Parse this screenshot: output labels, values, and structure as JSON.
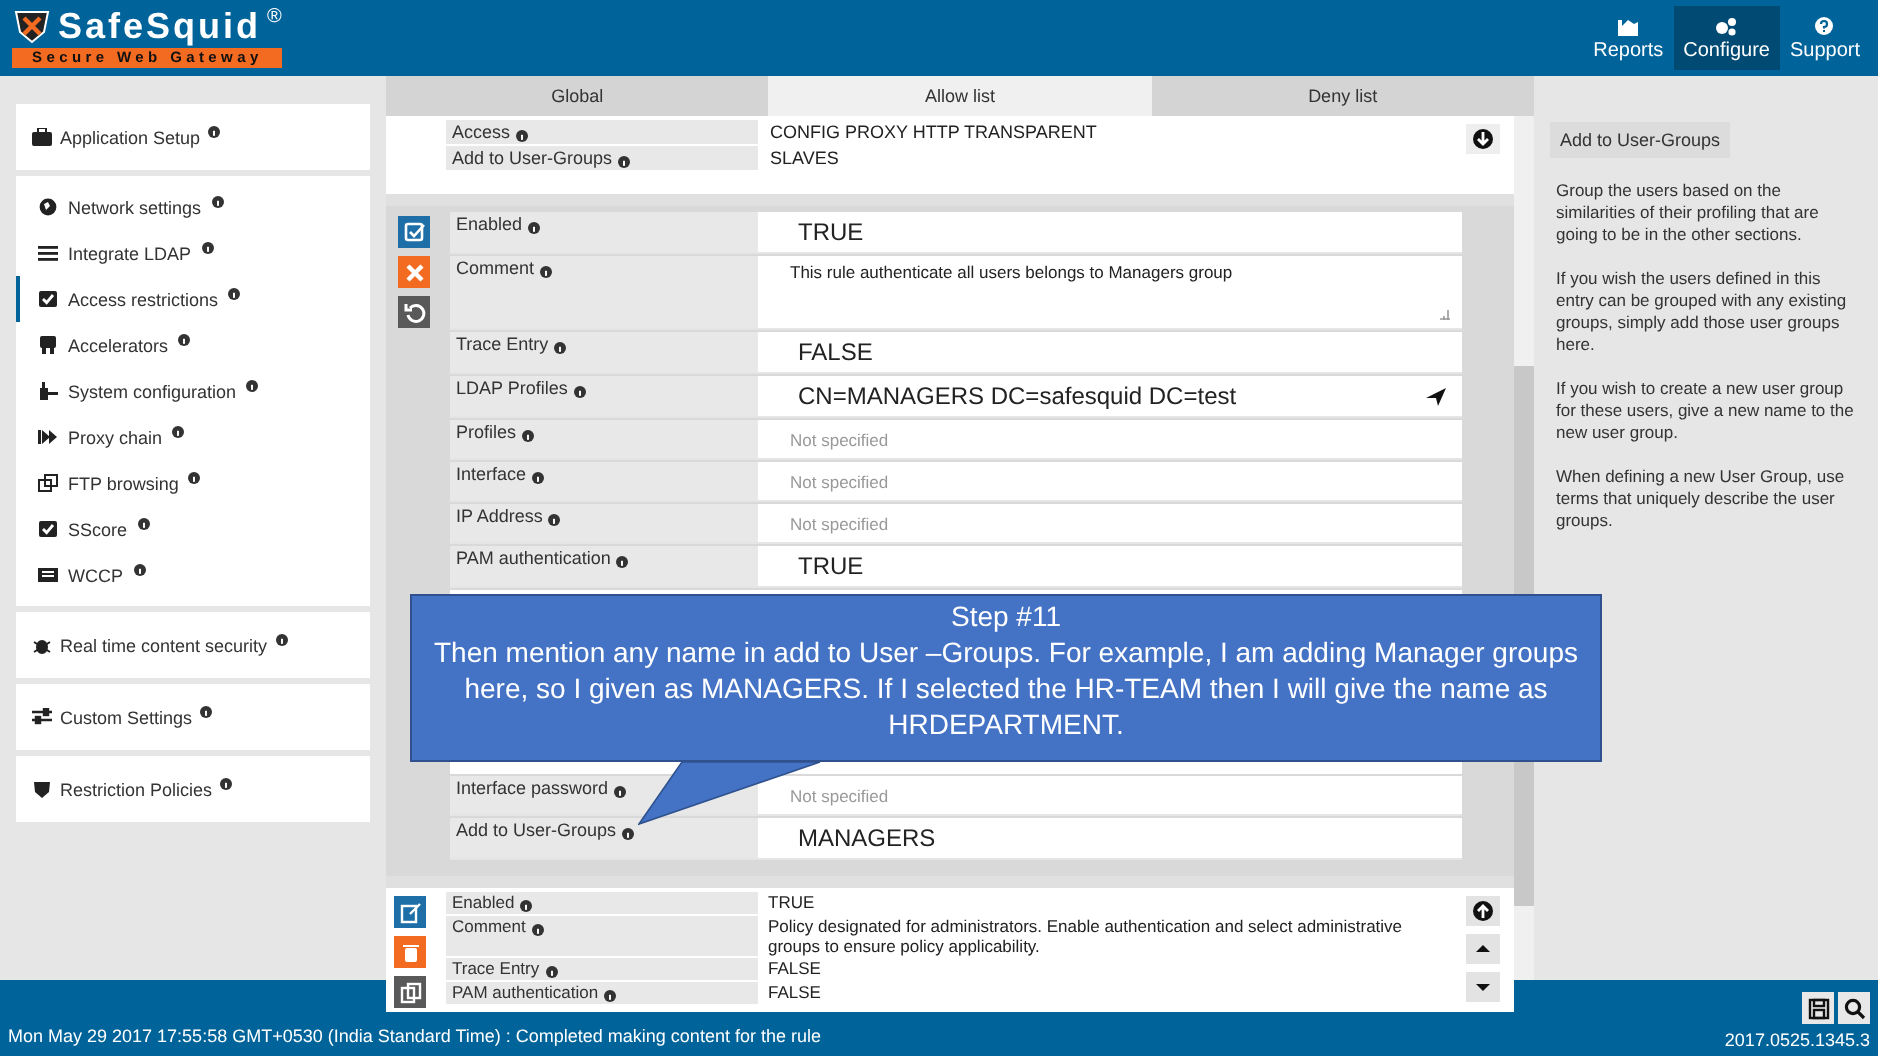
{
  "header": {
    "logo": {
      "name": "SafeSquid",
      "mark": "®",
      "tagline": "Secure Web Gateway"
    },
    "nav": [
      {
        "kind": "chart",
        "label": "Reports",
        "selected": false
      },
      {
        "kind": "gears",
        "label": "Configure",
        "selected": true
      },
      {
        "kind": "help",
        "label": "Support",
        "selected": false
      }
    ]
  },
  "sidebar": {
    "sections": [
      {
        "kind": "briefcase",
        "label": "Application Setup",
        "selected": false,
        "children": [
          {
            "kind": "globe",
            "label": "Network settings",
            "selected": false
          },
          {
            "kind": "bars",
            "label": "Integrate LDAP",
            "selected": false
          },
          {
            "kind": "check",
            "label": "Access restrictions",
            "selected": true
          },
          {
            "kind": "chip",
            "label": "Accelerators",
            "selected": false
          },
          {
            "kind": "plug",
            "label": "System configuration",
            "selected": false
          },
          {
            "kind": "forward",
            "label": "Proxy chain",
            "selected": false
          },
          {
            "kind": "copy",
            "label": "FTP browsing",
            "selected": false
          },
          {
            "kind": "check",
            "label": "SScore",
            "selected": false
          },
          {
            "kind": "list",
            "label": "WCCP",
            "selected": false
          }
        ]
      },
      {
        "kind": "bug",
        "label": "Real time content security",
        "selected": false
      },
      {
        "kind": "sliders",
        "label": "Custom Settings",
        "selected": false
      },
      {
        "kind": "shield",
        "label": "Restriction Policies",
        "selected": false
      }
    ]
  },
  "tabs": [
    {
      "label": "Global",
      "selected": false
    },
    {
      "label": "Allow list",
      "selected": true
    },
    {
      "label": "Deny list",
      "selected": false
    }
  ],
  "entries": [
    {
      "editing": false,
      "side_buttons": [
        {
          "kind": "down-circle"
        }
      ],
      "rows": [
        {
          "label": "Access",
          "kind": "text",
          "value": "CONFIG  PROXY  HTTP  TRANSPARENT"
        },
        {
          "label": "Add to User-Groups",
          "kind": "text",
          "value": "SLAVES"
        }
      ]
    },
    {
      "editing": true,
      "actions": [
        {
          "kind": "check",
          "color": "#1e6fa8"
        },
        {
          "kind": "close",
          "color": "#f26b21"
        },
        {
          "kind": "undo",
          "color": "#595959"
        }
      ],
      "rows": [
        {
          "label": "Enabled",
          "kind": "text",
          "value": "TRUE"
        },
        {
          "label": "Comment",
          "kind": "textarea",
          "value": "This rule authenticate all users belongs to Managers group"
        },
        {
          "label": "Trace Entry",
          "kind": "text",
          "value": "FALSE"
        },
        {
          "label": "LDAP Profiles",
          "kind": "link",
          "value": "CN=MANAGERS DC=safesquid DC=test"
        },
        {
          "label": "Profiles",
          "kind": "placeholder",
          "placeholder": "Not specified"
        },
        {
          "label": "Interface",
          "kind": "placeholder",
          "placeholder": "Not specified"
        },
        {
          "label": "IP Address",
          "kind": "placeholder",
          "placeholder": "Not specified"
        },
        {
          "label": "PAM authentication",
          "kind": "text",
          "value": "TRUE"
        }
      ],
      "rows_below_callout": [
        {
          "label": "Interface password",
          "kind": "placeholder",
          "placeholder": "Not specified"
        },
        {
          "label": "Add to User-Groups",
          "kind": "text",
          "value": "MANAGERS"
        }
      ]
    },
    {
      "editing": false,
      "actions": [
        {
          "kind": "edit",
          "color": "#1e6fa8"
        },
        {
          "kind": "trash",
          "color": "#f26b21"
        },
        {
          "kind": "copy",
          "color": "#595959"
        }
      ],
      "side_buttons": [
        {
          "kind": "up-circle"
        },
        {
          "kind": "up"
        },
        {
          "kind": "down"
        }
      ],
      "rows": [
        {
          "label": "Enabled",
          "kind": "text",
          "value": "TRUE"
        },
        {
          "label": "Comment",
          "kind": "text",
          "value": "Policy designated for administrators. Enable authentication and select administrative groups to ensure policy applicability."
        },
        {
          "label": "Trace Entry",
          "kind": "text",
          "value": "FALSE"
        },
        {
          "label": "PAM authentication",
          "kind": "text",
          "value": "FALSE"
        }
      ]
    }
  ],
  "callout": {
    "title": "Step #11",
    "text": "Then mention any name in add to User –Groups. For example, I am adding Manager groups here, so I given as MANAGERS. If I selected the HR-TEAM then I will give the name as HRDEPARTMENT."
  },
  "help": {
    "title": "Add to User-Groups",
    "paragraphs": [
      "Group the users based on the similarities of their profiling that are going to be in the other sections.",
      "If you wish the users defined in this entry can be grouped with any existing groups, simply add those user groups here.",
      "If you wish to create a new user group for these users, give a new name to the new user group.",
      "When defining a new User Group, use terms that uniquely describe the user groups."
    ]
  },
  "status_bar": {
    "message": "Mon May 29 2017 17:55:58 GMT+0530 (India Standard Time) : Completed making content for the rule",
    "version": "2017.0525.1345.3",
    "buttons": [
      {
        "kind": "save"
      },
      {
        "kind": "search"
      }
    ]
  }
}
